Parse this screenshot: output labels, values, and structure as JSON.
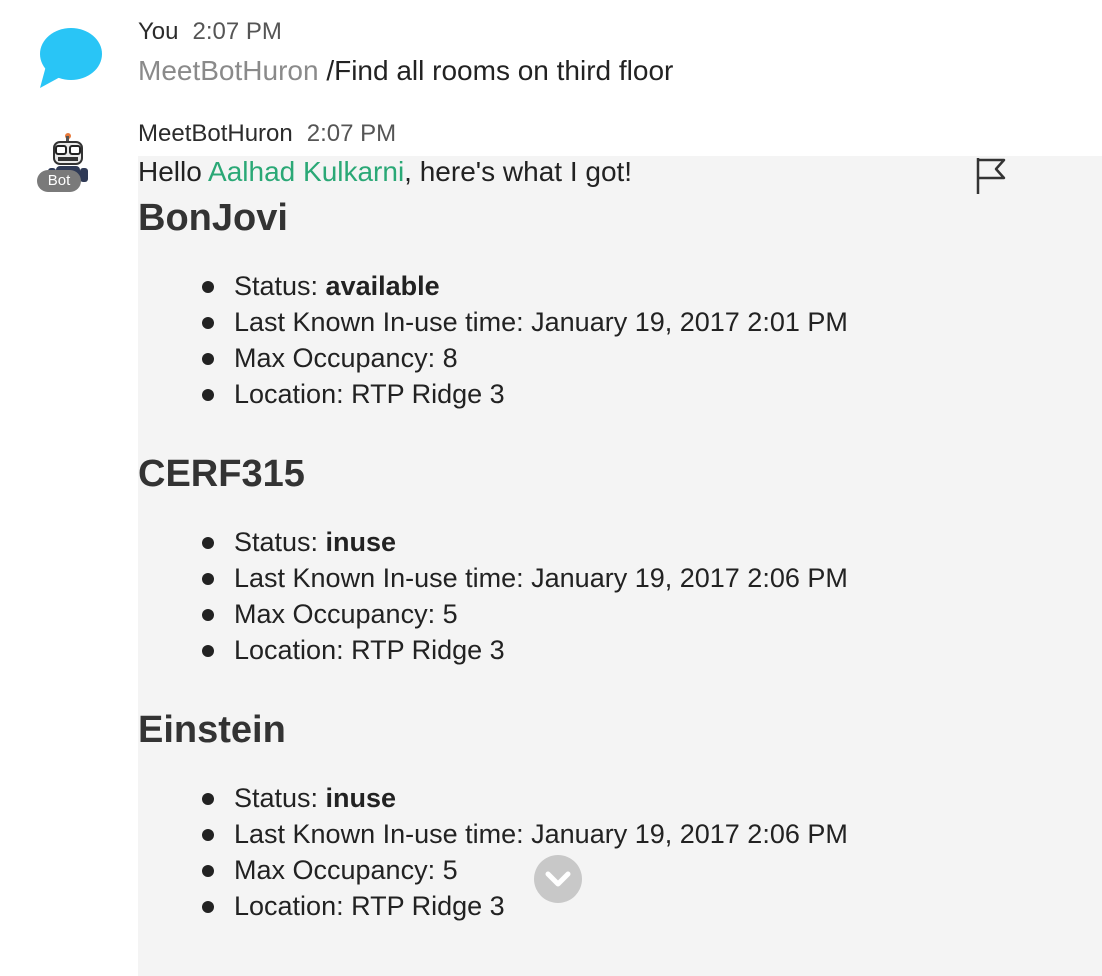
{
  "message_1": {
    "sender": "You",
    "time": "2:07 PM",
    "mention": "MeetBotHuron",
    "command": " /Find all rooms on third floor"
  },
  "message_2": {
    "sender": "MeetBotHuron",
    "time": "2:07 PM",
    "bot_badge": "Bot",
    "greeting_prefix": "Hello ",
    "greeting_user": "Aalhad Kulkarni",
    "greeting_suffix": ", here's what I got!",
    "rooms": [
      {
        "name": "BonJovi",
        "status_label": "Status: ",
        "status": "available",
        "last_known": "Last Known In-use time: January 19, 2017 2:01 PM",
        "max_occupancy": "Max Occupancy: 8",
        "location": "Location: RTP Ridge 3"
      },
      {
        "name": "CERF315",
        "status_label": "Status: ",
        "status": "inuse",
        "last_known": "Last Known In-use time: January 19, 2017 2:06 PM",
        "max_occupancy": "Max Occupancy: 5",
        "location": "Location: RTP Ridge 3"
      },
      {
        "name": "Einstein",
        "status_label": "Status: ",
        "status": "inuse",
        "last_known": "Last Known In-use time: January 19, 2017 2:06 PM",
        "max_occupancy": "Max Occupancy: 5",
        "location": "Location: RTP Ridge 3"
      }
    ]
  },
  "icons": {
    "you_avatar": "chat-bubble-icon",
    "bot_avatar": "robot-icon",
    "flag": "flag-icon",
    "scroll_down": "chevron-down-icon"
  },
  "colors": {
    "you_avatar": "#29c5f6",
    "mention_user": "#2aa876",
    "card_background": "#f4f4f4"
  }
}
